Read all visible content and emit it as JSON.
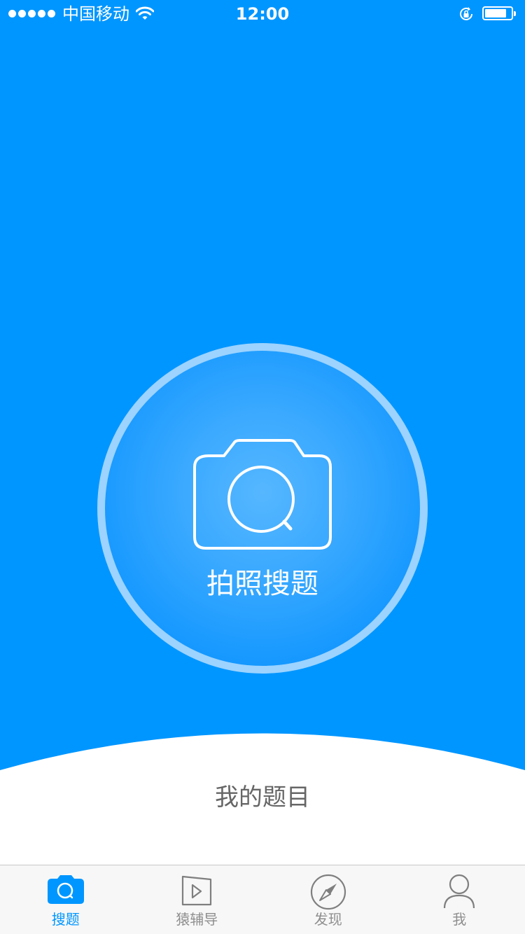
{
  "status_bar": {
    "carrier": "中国移动",
    "time": "12:00",
    "icons": [
      "signal-dots",
      "wifi-icon",
      "rotation-lock-icon",
      "battery-icon"
    ]
  },
  "main": {
    "capture_label": "拍照搜题",
    "capture_icon": "camera-search-icon"
  },
  "bottom": {
    "my_questions_label": "我的题目"
  },
  "tab_bar": {
    "tabs": [
      {
        "label": "搜题",
        "icon": "camera-search-icon",
        "active": true
      },
      {
        "label": "猿辅导",
        "icon": "video-play-icon",
        "active": false
      },
      {
        "label": "发现",
        "icon": "compass-icon",
        "active": false
      },
      {
        "label": "我",
        "icon": "person-icon",
        "active": false
      }
    ]
  },
  "colors": {
    "primary": "#0096FF",
    "ring": "#9CD3FF",
    "tab_active": "#0096FF",
    "tab_inactive": "#8E8E8E",
    "tab_background": "#F7F7F7",
    "text_secondary": "#666666"
  }
}
